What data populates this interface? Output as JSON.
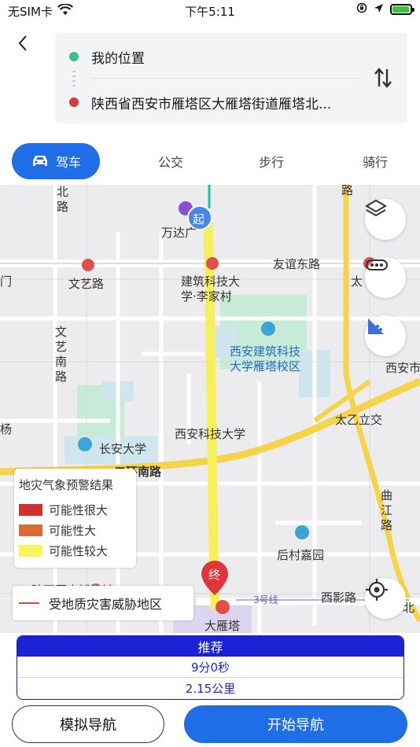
{
  "status_bar": {
    "carrier": "无SIM卡",
    "time": "下午5:11"
  },
  "route": {
    "origin": "我的位置",
    "destination": "陕西省西安市雁塔区大雁塔街道雁塔北..."
  },
  "tabs": [
    {
      "label": "驾车",
      "active": true
    },
    {
      "label": "公交",
      "active": false
    },
    {
      "label": "步行",
      "active": false
    },
    {
      "label": "骑行",
      "active": false
    }
  ],
  "map": {
    "labels": {
      "wanda": "万达广",
      "youyi_east": "友谊东路",
      "wenyi": "文艺路",
      "jianzhu_uni": "建筑科技大",
      "jianzhu_li": "学·李家村",
      "jianzhu_campus_1": "西安建筑科技",
      "jianzhu_campus_2": "大学雁塔校区",
      "wenyi_south": "文艺南路",
      "taiyi": "太乙立交",
      "xian_sci": "西安科技大学",
      "changan_uni": "长安大学",
      "second_ring": "二环南路",
      "qujiang": "曲江路",
      "houcun": "后村嘉园",
      "line3": "3号线",
      "xiying": "西影路",
      "dayanta": "大雁塔",
      "shaanxi_museum": "陕西历史博物馆",
      "xian_right": "西安市",
      "north_road": "北路",
      "road_top_right": "路",
      "tai_right": "太",
      "men_left": "门",
      "yang_left": "杨",
      "bei_right": "北",
      "start_marker": "起",
      "end_marker": "终"
    },
    "legend": {
      "title": "地灾气象预警结果",
      "items": [
        {
          "label": "可能性很大",
          "color": "#d0312d"
        },
        {
          "label": "可能性大",
          "color": "#dd6a36"
        },
        {
          "label": "可能性较大",
          "color": "#fbf55c"
        }
      ]
    },
    "threat_area": "受地质灾害威胁地区",
    "route_color": "#f7f05a"
  },
  "route_card": {
    "title": "推荐",
    "duration": "9分0秒",
    "distance": "2.15公里"
  },
  "buttons": {
    "simulate": "模拟导航",
    "start": "开始导航"
  },
  "colors": {
    "accent": "#1f6ee8",
    "origin_dot": "#3bbd8e",
    "destination_dot": "#e0353a"
  }
}
